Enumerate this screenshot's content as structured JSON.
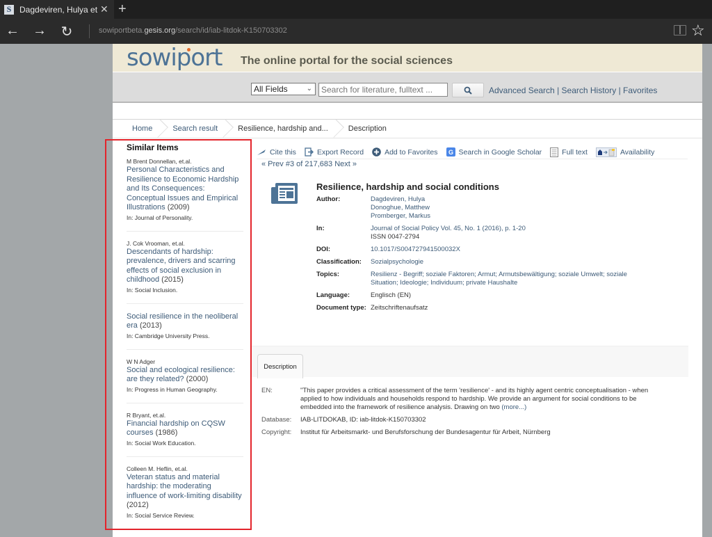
{
  "browser": {
    "tab_title": "Dagdeviren, Hulya et. al",
    "favicon_letter": "S",
    "url_prefix": "sowiportbeta.",
    "url_domain": "gesis.org",
    "url_path": "/search/id/iab-litdok-K150703302",
    "back_glyph": "←",
    "forward_glyph": "→",
    "refresh_glyph": "↻",
    "new_tab_glyph": "+",
    "close_glyph": "✕",
    "star_glyph": "☆"
  },
  "header": {
    "logo": "sowiport",
    "tagline": "The online portal for the social sciences"
  },
  "search": {
    "field_selected": "All Fields",
    "placeholder": "Search for literature, fulltext ...",
    "links": [
      "Advanced Search",
      "Search History",
      "Favorites"
    ],
    "separator": " | "
  },
  "breadcrumb": [
    "Home",
    "Search result",
    "Resilience, hardship and...",
    "Description"
  ],
  "sidebar": {
    "heading": "Similar Items",
    "items": [
      {
        "author": "M Brent Donnellan, et.al.",
        "title": "Personal Characteristics and Resilience to Economic Hardship and Its Consequences: Conceptual Issues and Empirical Illustrations",
        "year": "(2009)",
        "source": "In: Journal of Personality."
      },
      {
        "author": "J. Cok Vrooman, et.al.",
        "title": "Descendants of hardship: prevalence, drivers and scarring effects of social exclusion in childhood",
        "year": "(2015)",
        "source": "In: Social Inclusion."
      },
      {
        "author": "",
        "title": "Social resilience in the neoliberal era",
        "year": "(2013)",
        "source": "In: Cambridge University Press."
      },
      {
        "author": "W N Adger",
        "title": "Social and ecological resilience: are they related?",
        "year": "(2000)",
        "source": "In: Progress in Human Geography."
      },
      {
        "author": "R Bryant, et.al.",
        "title": "Financial hardship on CQSW courses",
        "year": "(1986)",
        "source": "In: Social Work Education."
      },
      {
        "author": "Colleen M. Heflin, et.al.",
        "title": "Veteran status and material hardship: the moderating influence of work-limiting disability",
        "year": "(2012)",
        "source": "In: Social Service Review."
      }
    ]
  },
  "toolbar": {
    "cite": "Cite this",
    "export": "Export Record",
    "favorites": "Add to Favorites",
    "scholar": "Search in Google Scholar",
    "fulltext": "Full text",
    "availability": "Availability"
  },
  "pager": "« Prev #3 of 217,683 Next »",
  "record": {
    "title": "Resilience, hardship and social conditions",
    "labels": {
      "author": "Author:",
      "in": "In:",
      "doi": "DOI:",
      "classification": "Classification:",
      "topics": "Topics:",
      "language": "Language:",
      "doctype": "Document type:"
    },
    "authors": [
      "Dagdeviren, Hulya",
      "Donoghue, Matthew",
      "Promberger, Markus"
    ],
    "in": "Journal of Social Policy Vol. 45, No. 1 (2016), p. 1-20",
    "issn": "ISSN 0047-2794",
    "doi": "10.1017/S004727941500032X",
    "classification": "Sozialpsychologie",
    "topics": "Resilienz - Begriff; soziale Faktoren; Armut; Armutsbewältigung; soziale Umwelt; soziale Situation; Ideologie; Individuum; private Haushalte",
    "language": "Englisch (EN)",
    "doctype": "Zeitschriftenaufsatz"
  },
  "description": {
    "tab": "Description",
    "labels": {
      "en": "EN:",
      "database": "Database:",
      "copyright": "Copyright:"
    },
    "abstract": "\"This paper provides a critical assessment of the term 'resilience' - and its highly agent centric conceptualisation - when applied to how individuals and households respond to hardship. We provide an argument for social conditions to be embedded into the framework of resilience analysis. Drawing on two",
    "more": "(more...)",
    "database": "IAB-LITDOKAB, ID: iab-litdok-K150703302",
    "copyright": "Institut für Arbeitsmarkt- und Berufsforschung der Bundesagentur für Arbeit, Nürnberg"
  },
  "colors": {
    "link": "#3d5b78",
    "highlight": "#e3242b",
    "header_band": "#efe9d5"
  }
}
